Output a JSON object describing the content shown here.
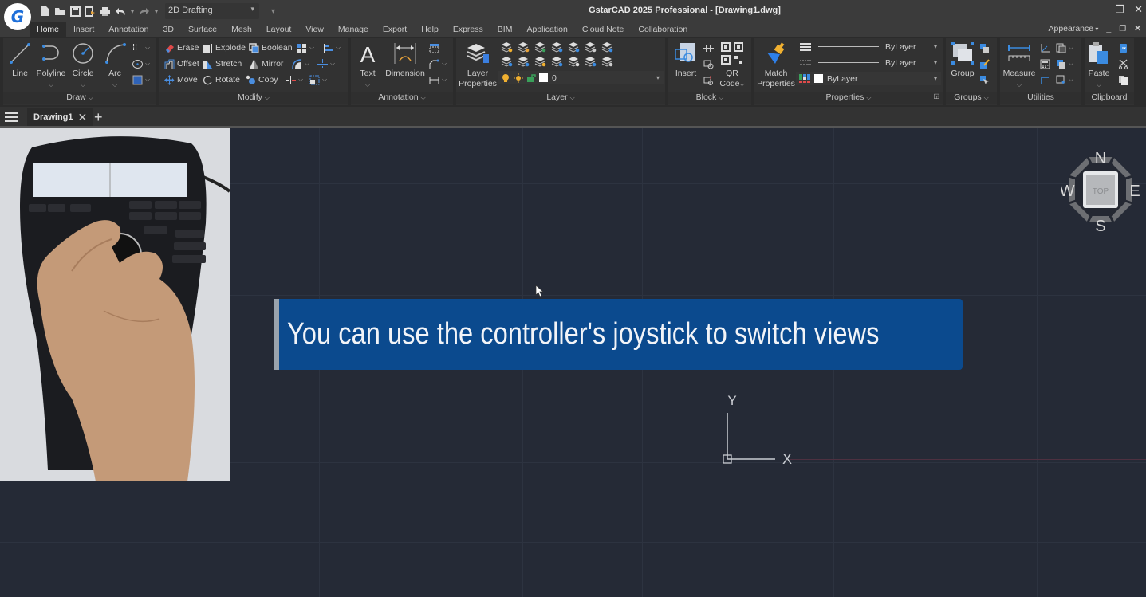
{
  "app": {
    "title": "GstarCAD 2025 Professional - [Drawing1.dwg]",
    "logo_letter": "G",
    "workspace": "2D Drafting",
    "window_controls": [
      "minimize",
      "restore",
      "close"
    ]
  },
  "quick_access": [
    {
      "name": "new-file-icon",
      "glyph": "▮"
    },
    {
      "name": "open-folder-icon",
      "glyph": "▬"
    },
    {
      "name": "save-icon",
      "glyph": "⊟"
    },
    {
      "name": "save-as-icon",
      "glyph": "⇲"
    },
    {
      "name": "print-icon",
      "glyph": "⎙"
    },
    {
      "name": "undo-icon",
      "glyph": "↶"
    },
    {
      "name": "redo-icon",
      "glyph": "↷"
    }
  ],
  "menu_tabs": [
    "Home",
    "Insert",
    "Annotation",
    "3D",
    "Surface",
    "Mesh",
    "Layout",
    "View",
    "Manage",
    "Export",
    "Help",
    "Express",
    "BIM",
    "Application",
    "Cloud Note",
    "Collaboration"
  ],
  "active_tab": "Home",
  "appearance_label": "Appearance",
  "ribbon": {
    "draw": {
      "label": "Draw",
      "buttons": [
        "Line",
        "Polyline",
        "Circle",
        "Arc"
      ]
    },
    "modify": {
      "label": "Modify",
      "rows": [
        [
          "Erase",
          "Explode",
          "Boolean"
        ],
        [
          "Offset",
          "Stretch",
          "Mirror"
        ],
        [
          "Move",
          "Rotate",
          "Copy"
        ]
      ]
    },
    "annotation": {
      "label": "Annotation",
      "buttons": [
        "Text",
        "Dimension"
      ]
    },
    "layer": {
      "label": "Layer",
      "button_line1": "Layer",
      "button_line2": "Properties",
      "current_layer": "0"
    },
    "block": {
      "label": "Block",
      "buttons": [
        "Insert"
      ],
      "qr_line1": "QR",
      "qr_line2": "Code"
    },
    "properties": {
      "label": "Properties",
      "match_line1": "Match",
      "match_line2": "Properties",
      "lineweight": "ByLayer",
      "linetype": "ByLayer",
      "color": "ByLayer"
    },
    "groups": {
      "label": "Groups",
      "button": "Group"
    },
    "utilities": {
      "label": "Utilities",
      "button": "Measure"
    },
    "clipboard": {
      "label": "Clipboard",
      "button": "Paste"
    }
  },
  "document_tabs": [
    {
      "label": "Drawing1",
      "active": true
    }
  ],
  "viewcube": {
    "north": "N",
    "south": "S",
    "east": "E",
    "west": "W",
    "face": "TOP"
  },
  "ucs": {
    "x_label": "X",
    "y_label": "Y"
  },
  "caption": "You can use the controller's joystick to switch views",
  "colors": {
    "caption_bg": "#0b4a8e",
    "canvas_bg": "#252a36",
    "ribbon_bg": "#2b2b2b",
    "accent_blue": "#3b8be0"
  }
}
